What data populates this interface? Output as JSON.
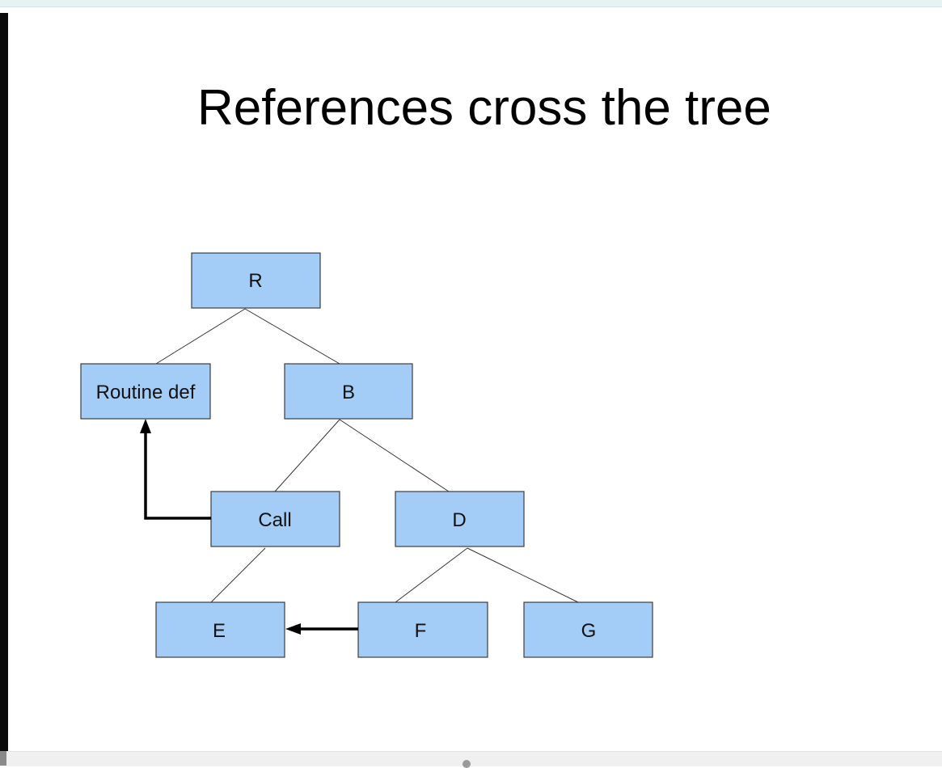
{
  "slide": {
    "title": "References cross the tree"
  },
  "diagram": {
    "nodes": {
      "r": "R",
      "routine_def": "Routine def",
      "b": "B",
      "call": "Call",
      "d": "D",
      "e": "E",
      "f": "F",
      "g": "G"
    },
    "colors": {
      "node_fill": "#a3cdf6",
      "node_border": "#3d3d3d",
      "reference_arrow": "#000000"
    }
  }
}
